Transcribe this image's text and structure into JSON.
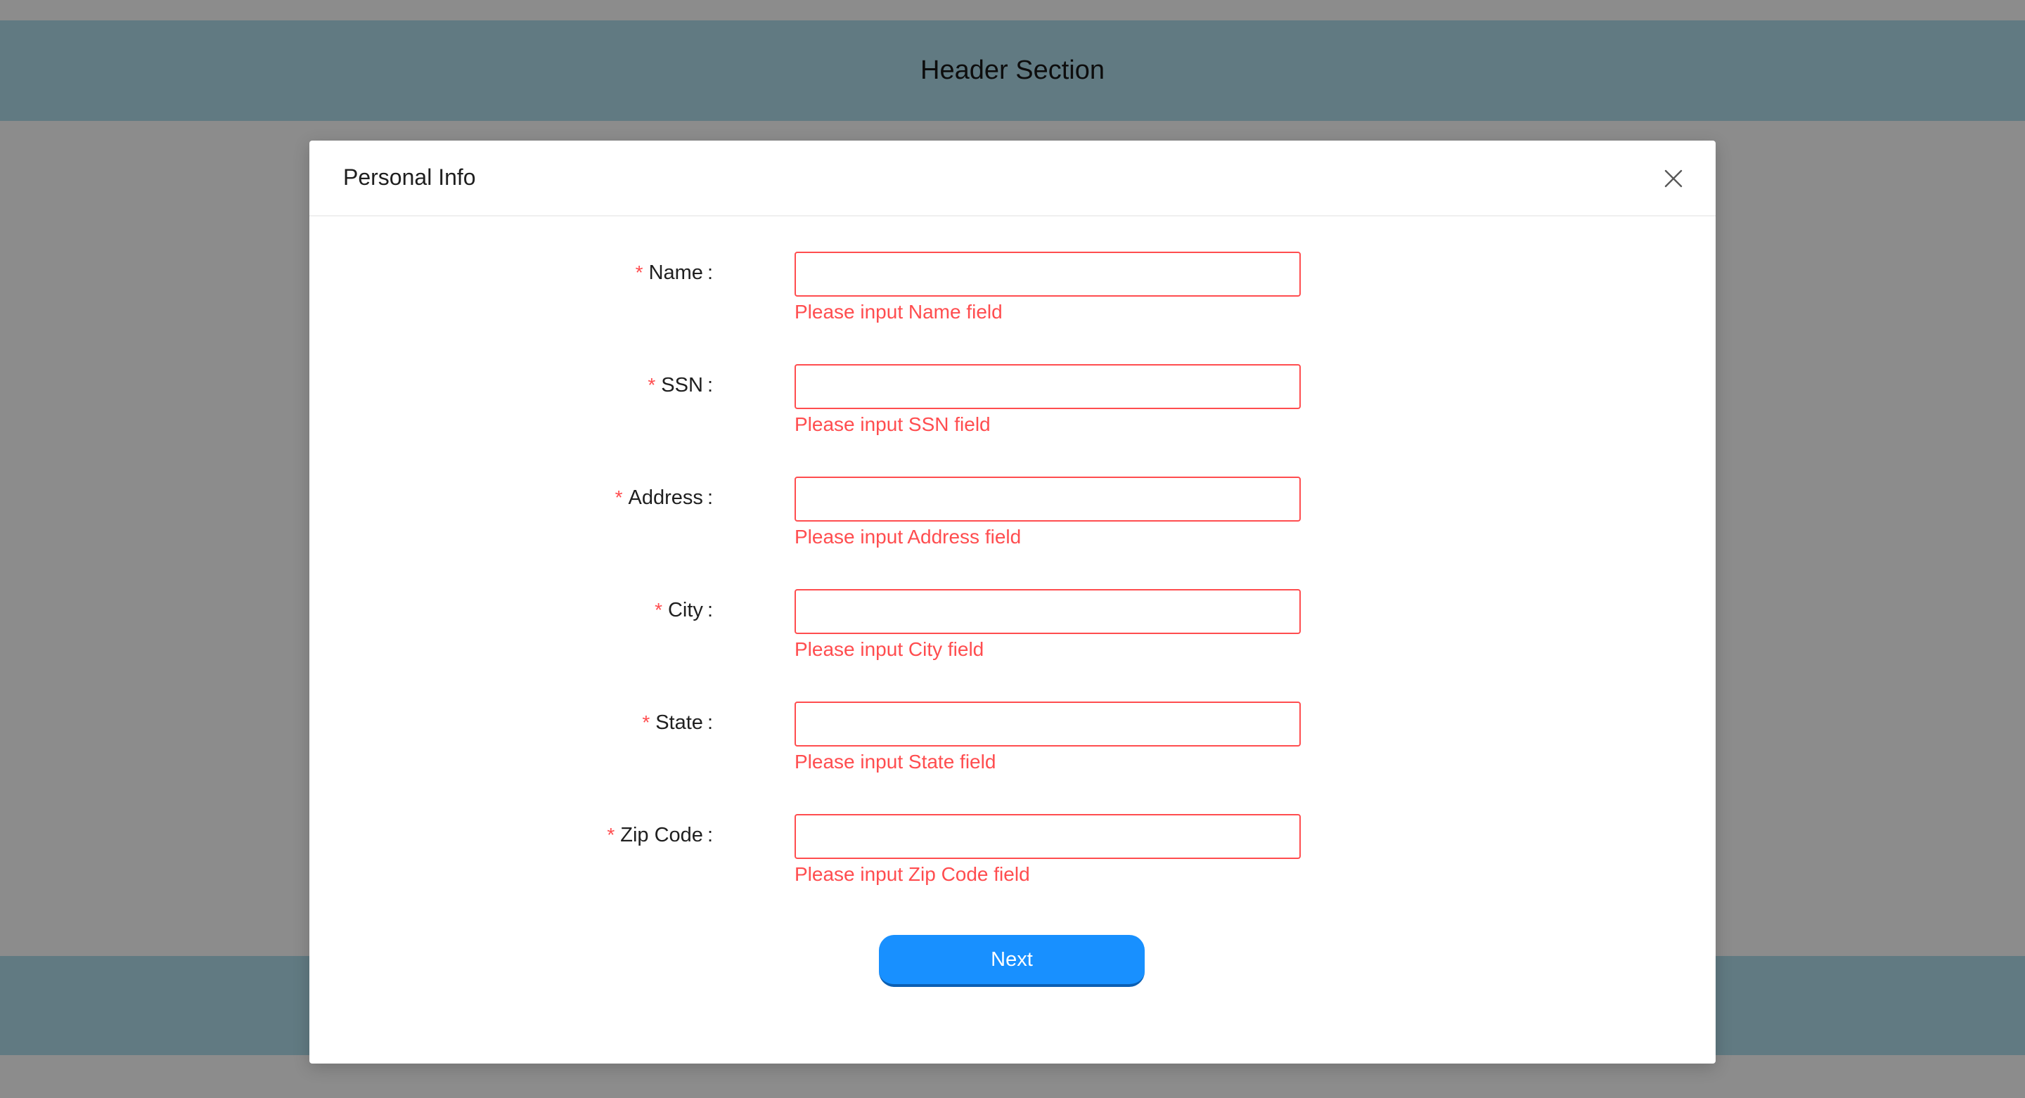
{
  "page": {
    "header_title": "Header Section"
  },
  "modal": {
    "title": "Personal Info",
    "close_icon": "close-icon",
    "next_label": "Next",
    "required_mark": "*",
    "label_suffix": ":"
  },
  "fields": [
    {
      "label": "Name",
      "value": "",
      "placeholder": "",
      "error": "Please input Name field"
    },
    {
      "label": "SSN",
      "value": "",
      "placeholder": "",
      "error": "Please input SSN field"
    },
    {
      "label": "Address",
      "value": "",
      "placeholder": "",
      "error": "Please input Address field"
    },
    {
      "label": "City",
      "value": "",
      "placeholder": "",
      "error": "Please input City field"
    },
    {
      "label": "State",
      "value": "",
      "placeholder": "",
      "error": "Please input State field"
    },
    {
      "label": "Zip Code",
      "value": "",
      "placeholder": "",
      "error": "Please input Zip Code field"
    }
  ],
  "colors": {
    "error": "#ff4d4f",
    "primary": "#1890ff",
    "band": "#617a82",
    "overlay": "#8c8c8c"
  }
}
